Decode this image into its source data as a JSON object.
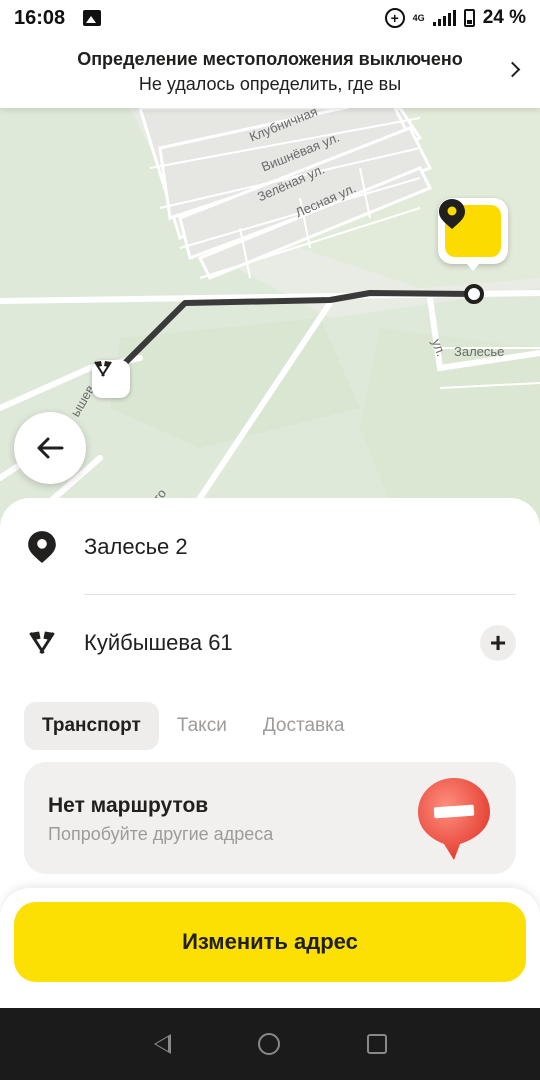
{
  "status_bar": {
    "time": "16:08",
    "network": "4G",
    "battery": "24 %",
    "icons": [
      "image-icon",
      "data-saver-icon",
      "signal-icon",
      "battery-icon"
    ]
  },
  "location_banner": {
    "title": "Определение местоположения выключено",
    "subtitle": "Не удалось определить, где вы"
  },
  "map": {
    "street_labels": [
      "Клубничная",
      "Вишнёвая ул.",
      "Зелёная ул.",
      "Лесная ул.",
      "Залесье",
      "ул.",
      "ышев",
      "го"
    ],
    "route_color": "#3a3a3a",
    "accent": "#fcdb00"
  },
  "route": {
    "destination": "Залесье 2",
    "origin": "Куйбышева 61"
  },
  "tabs": [
    {
      "label": "Транспорт",
      "active": true
    },
    {
      "label": "Такси",
      "active": false
    },
    {
      "label": "Доставка",
      "active": false
    }
  ],
  "no_routes": {
    "title": "Нет маршрутов",
    "subtitle": "Попробуйте другие адреса"
  },
  "action": {
    "change_address_label": "Изменить адрес",
    "color": "#fcdf03"
  }
}
